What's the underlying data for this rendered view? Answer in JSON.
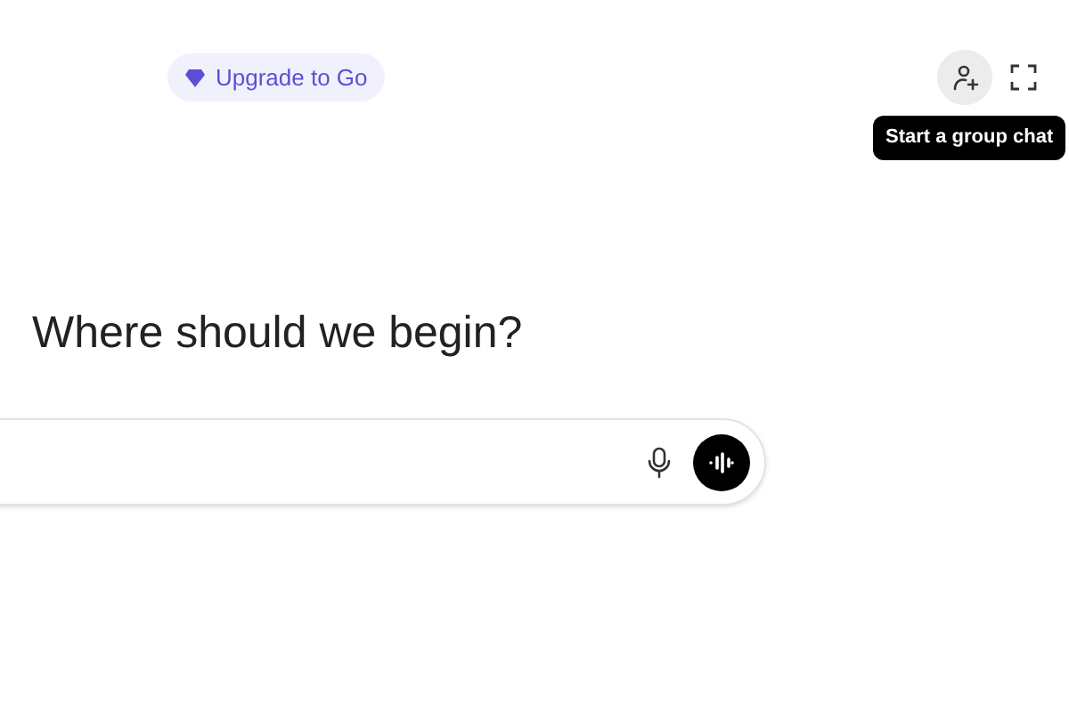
{
  "upgrade_badge": {
    "label": "Upgrade to Go"
  },
  "tooltip": {
    "text": "Start a group chat"
  },
  "heading": "Where should we begin?"
}
